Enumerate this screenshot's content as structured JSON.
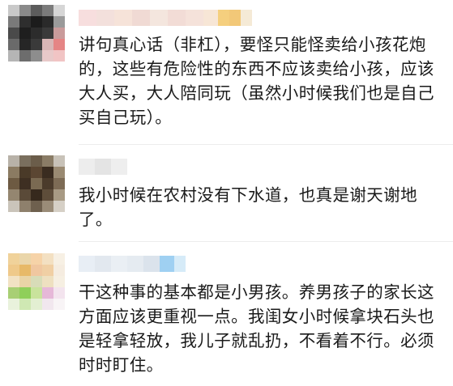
{
  "comments": [
    {
      "lines": [
        "讲句真心话（非杠），要怪只能怪卖给小孩花炮",
        "的，这些有危险性的东西不应该卖给小孩，应该",
        "大人买，大人陪同玩（虽然小时候我们也是自己",
        "买自己玩）。"
      ]
    },
    {
      "lines": [
        "我小时候在农村没有下水道，也真是谢天谢地",
        "了。"
      ]
    },
    {
      "lines": [
        "干这种事的基本都是小男孩。养男孩子的家长这",
        "方面应该更重视一点。我闺女小时候拿块石头也",
        "是轻拿轻放，我儿子就乱扔，不看着不行。必须",
        "时时盯住。"
      ]
    }
  ]
}
